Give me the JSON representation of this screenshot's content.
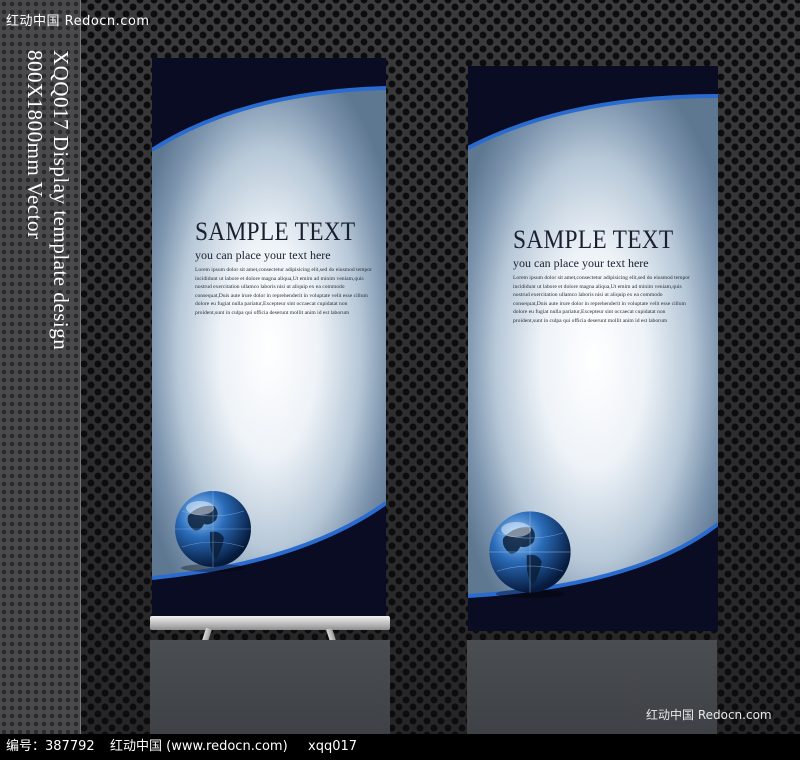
{
  "watermark": {
    "top_left": "红动中国 Redocn.com",
    "bottom_right": "红动中国 Redocn.com"
  },
  "side_title": {
    "line1": "XQQ017 Display template design",
    "line2": "800X1800mm Vector"
  },
  "banners": [
    {
      "headline": "SAMPLE TEXT",
      "subline": "you can place your text here",
      "body": [
        "Lorem ipsum dolor sit amet,consectetur adipisicing elit,sed do eiusmod tempor",
        "incididunt ut labore et dolore magna aliqua,Ut emim ad minim veniam,quis",
        "nostrud exercitation ullamco laboris nisi ut aliquip ex ea commodo",
        "consequat,Duis aute irure dolor in reprehenderit in voluptate velit esse cillum",
        "dolore eu fugiat nulla pariatur,Excepteur sint occaecat cupidatat non",
        "proident,sunt in culpa qui officia deserunt mollit anim id est laborum"
      ]
    },
    {
      "headline": "SAMPLE TEXT",
      "subline": "you can place your text here",
      "body": [
        "Lorem ipsum dolor sit amet,consectetur adipisicing elit,sed do eiusmod tempor",
        "incididunt ut labore et dolore magna aliqua,Ut emim ad minim veniam,quis",
        "nostrud exercitation ullamco laboris nisi ut aliquip ex ea commodo",
        "consequat,Duis aute irure dolor in reprehenderit in voluptate velit esse cillum",
        "dolore eu fugiat nulla pariatur,Excepteur sint occaecat cupidatat non",
        "proident,sunt in culpa qui officia deserunt mollit anim id est laborum"
      ]
    }
  ],
  "footer": {
    "id": "编号：387792",
    "site": "红动中国 (www.redocn.com)",
    "code": "xqq017"
  },
  "colors": {
    "frame_dark": "#0a0c24",
    "accent_blue": "#2a6bd0",
    "background": "#333335"
  },
  "icons": [
    "globe-icon"
  ]
}
